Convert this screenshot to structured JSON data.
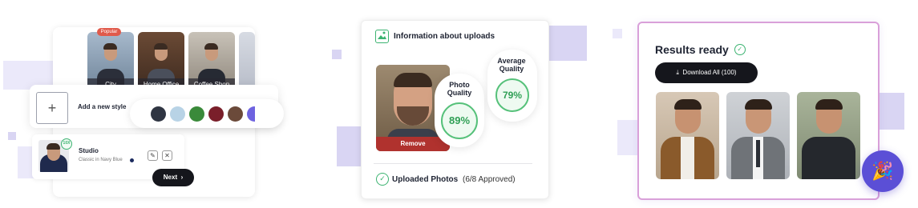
{
  "panel_styles": {
    "badge": "Popular",
    "styles": [
      {
        "label": "City"
      },
      {
        "label": "Home Office"
      },
      {
        "label": "Coffee Shop"
      }
    ],
    "add_style_label": "Add a new style",
    "add_icon": "plus-icon",
    "swatches": [
      "#2f3542",
      "#b8d3e6",
      "#3a8a3a",
      "#7a1f2a",
      "#6b4a3a",
      "#6e63e0"
    ],
    "selected": {
      "badge": "10X",
      "title": "Studio",
      "subtitle": "Classic in Navy Blue",
      "color": "#1b2a5e"
    },
    "edit_icon": "pencil-icon",
    "close_icon": "close-icon",
    "next_label": "Next",
    "next_icon": "chevron-right-icon"
  },
  "panel_uploads": {
    "title": "Information about uploads",
    "title_icon": "image-sparkle-icon",
    "remove_label": "Remove",
    "photo_quality": {
      "label": "Photo Quality",
      "value": "89%"
    },
    "average_quality": {
      "label": "Average Quality",
      "value": "79%"
    },
    "uploaded_label": "Uploaded Photos",
    "uploaded_count": "(6/8 Approved)",
    "accent": "#3cb371"
  },
  "panel_results": {
    "title": "Results ready",
    "title_icon": "check-circle-icon",
    "download_label": "Download All (100)",
    "download_icon": "download-icon",
    "fab_icon": "party-popper-icon",
    "fab_color": "#5b4fd6"
  }
}
